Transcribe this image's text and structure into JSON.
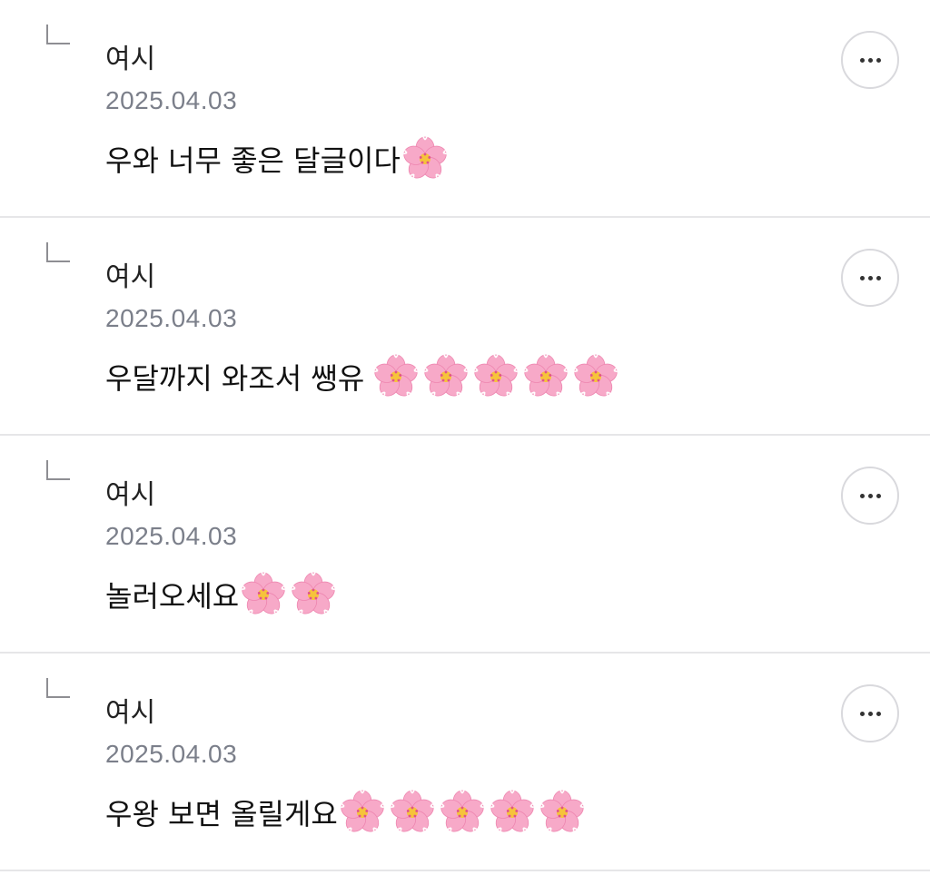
{
  "replies": [
    {
      "author": "여시",
      "date": "2025.04.03",
      "text": "우와 너무 좋은 달글이다",
      "flower_count": 1,
      "flower_icon": "cherry-blossom-icon"
    },
    {
      "author": "여시",
      "date": "2025.04.03",
      "text": "우달까지 와조서 쌩유",
      "flower_count": 5,
      "flower_icon": "cherry-blossom-icon"
    },
    {
      "author": "여시",
      "date": "2025.04.03",
      "text": "놀러오세요",
      "flower_count": 2,
      "flower_icon": "cherry-blossom-icon"
    },
    {
      "author": "여시",
      "date": "2025.04.03",
      "text": "우왕 보면 올릴게요",
      "flower_count": 5,
      "flower_icon": "cherry-blossom-icon"
    }
  ],
  "colors": {
    "divider": "#e6e6e8",
    "date_text": "#7b7f8a",
    "reply_corner": "#8e8e93",
    "petal": "#f7a9c8",
    "flower_center": "#f6c33b"
  },
  "icons": {
    "reply": "reply-arrow-icon",
    "more": "more-horizontal-icon"
  }
}
